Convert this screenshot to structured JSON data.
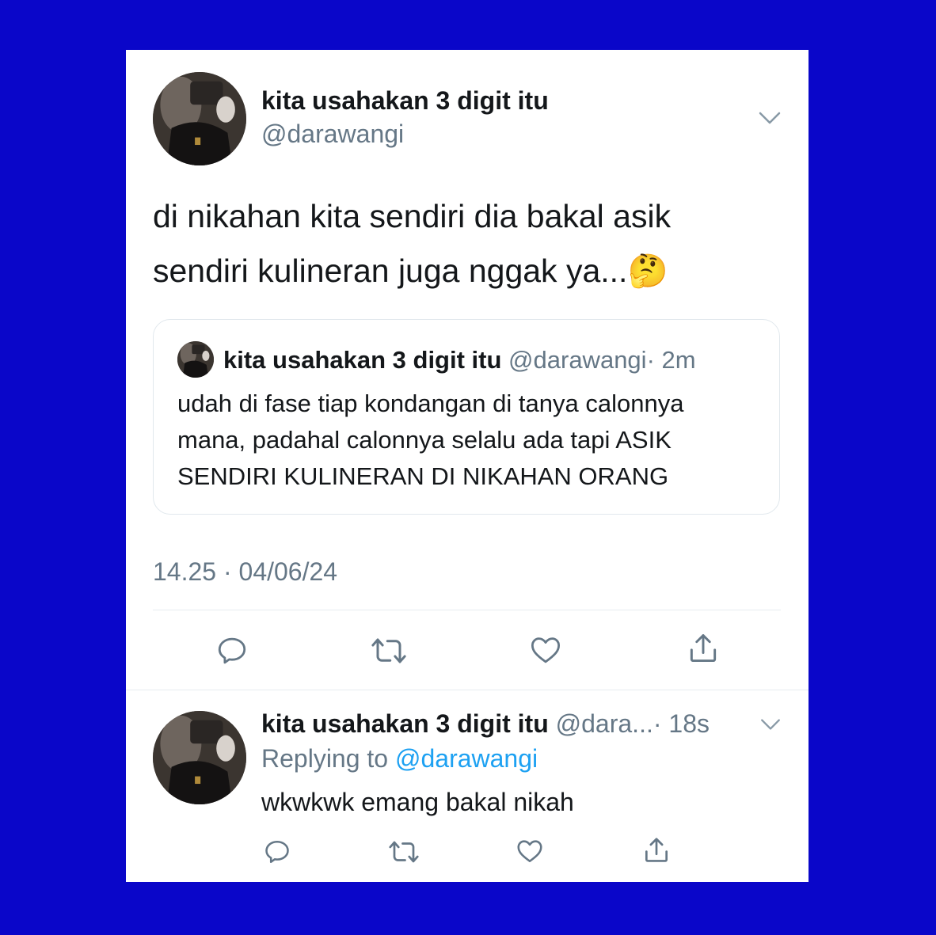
{
  "main_tweet": {
    "display_name": "kita usahakan 3 digit itu",
    "handle": "@darawangi",
    "text_line1": "di nikahan kita sendiri dia bakal asik",
    "text_line2": "sendiri kulineran juga nggak ya...",
    "emoji": "🤔",
    "timestamp": "14.25 · 04/06/24"
  },
  "quoted_tweet": {
    "display_name": "kita usahakan 3 digit itu",
    "handle": "@darawangi",
    "time": "· 2m",
    "line1": "udah di fase tiap kondangan di tanya calonnya",
    "line2": "mana, padahal calonnya selalu ada tapi ASIK",
    "line3": "SENDIRI KULINERAN DI NIKAHAN ORANG"
  },
  "reply_tweet": {
    "display_name": "kita usahakan 3 digit itu",
    "handle": "@dara...",
    "time": "· 18s",
    "replying_label": "Replying to",
    "replying_handle": "@darawangi",
    "text": "wkwkwk emang bakal nikah"
  },
  "icons": [
    "chevron-down-icon",
    "reply-icon",
    "retweet-icon",
    "like-icon",
    "share-icon"
  ],
  "colors": {
    "background": "#0a06c9",
    "card": "#ffffff",
    "link": "#1da1f2",
    "secondary": "#657786"
  }
}
